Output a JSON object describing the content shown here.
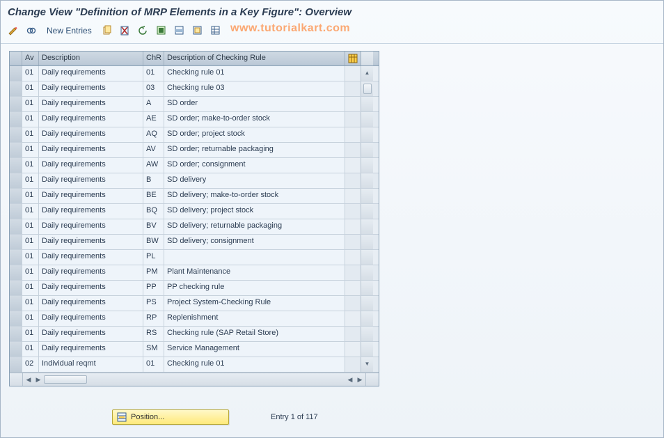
{
  "title": "Change View \"Definition of MRP Elements in a Key Figure\": Overview",
  "watermark": "www.tutorialkart.com",
  "toolbar": {
    "new_entries": "New Entries"
  },
  "columns": {
    "av": "Av",
    "description": "Description",
    "chr": "ChR",
    "chr_desc": "Description of Checking Rule"
  },
  "rows": [
    {
      "av": "01",
      "desc": "Daily requirements",
      "chr": "01",
      "cdesc": "Checking rule 01"
    },
    {
      "av": "01",
      "desc": "Daily requirements",
      "chr": "03",
      "cdesc": "Checking rule 03"
    },
    {
      "av": "01",
      "desc": "Daily requirements",
      "chr": "A",
      "cdesc": "SD order"
    },
    {
      "av": "01",
      "desc": "Daily requirements",
      "chr": "AE",
      "cdesc": "SD order; make-to-order stock"
    },
    {
      "av": "01",
      "desc": "Daily requirements",
      "chr": "AQ",
      "cdesc": "SD order; project stock"
    },
    {
      "av": "01",
      "desc": "Daily requirements",
      "chr": "AV",
      "cdesc": "SD order; returnable packaging"
    },
    {
      "av": "01",
      "desc": "Daily requirements",
      "chr": "AW",
      "cdesc": "SD order; consignment"
    },
    {
      "av": "01",
      "desc": "Daily requirements",
      "chr": "B",
      "cdesc": "SD delivery"
    },
    {
      "av": "01",
      "desc": "Daily requirements",
      "chr": "BE",
      "cdesc": "SD delivery; make-to-order stock"
    },
    {
      "av": "01",
      "desc": "Daily requirements",
      "chr": "BQ",
      "cdesc": "SD delivery; project stock"
    },
    {
      "av": "01",
      "desc": "Daily requirements",
      "chr": "BV",
      "cdesc": "SD delivery; returnable packaging"
    },
    {
      "av": "01",
      "desc": "Daily requirements",
      "chr": "BW",
      "cdesc": "SD delivery; consignment"
    },
    {
      "av": "01",
      "desc": "Daily requirements",
      "chr": "PL",
      "cdesc": ""
    },
    {
      "av": "01",
      "desc": "Daily requirements",
      "chr": "PM",
      "cdesc": "Plant Maintenance"
    },
    {
      "av": "01",
      "desc": "Daily requirements",
      "chr": "PP",
      "cdesc": "PP checking rule"
    },
    {
      "av": "01",
      "desc": "Daily requirements",
      "chr": "PS",
      "cdesc": "Project System-Checking Rule"
    },
    {
      "av": "01",
      "desc": "Daily requirements",
      "chr": "RP",
      "cdesc": "Replenishment"
    },
    {
      "av": "01",
      "desc": "Daily requirements",
      "chr": "RS",
      "cdesc": "Checking rule (SAP Retail Store)"
    },
    {
      "av": "01",
      "desc": "Daily requirements",
      "chr": "SM",
      "cdesc": "Service Management"
    },
    {
      "av": "02",
      "desc": "Individual reqmt",
      "chr": "01",
      "cdesc": "Checking rule 01"
    }
  ],
  "footer": {
    "position_label": "Position...",
    "entry_info": "Entry 1 of 117"
  }
}
